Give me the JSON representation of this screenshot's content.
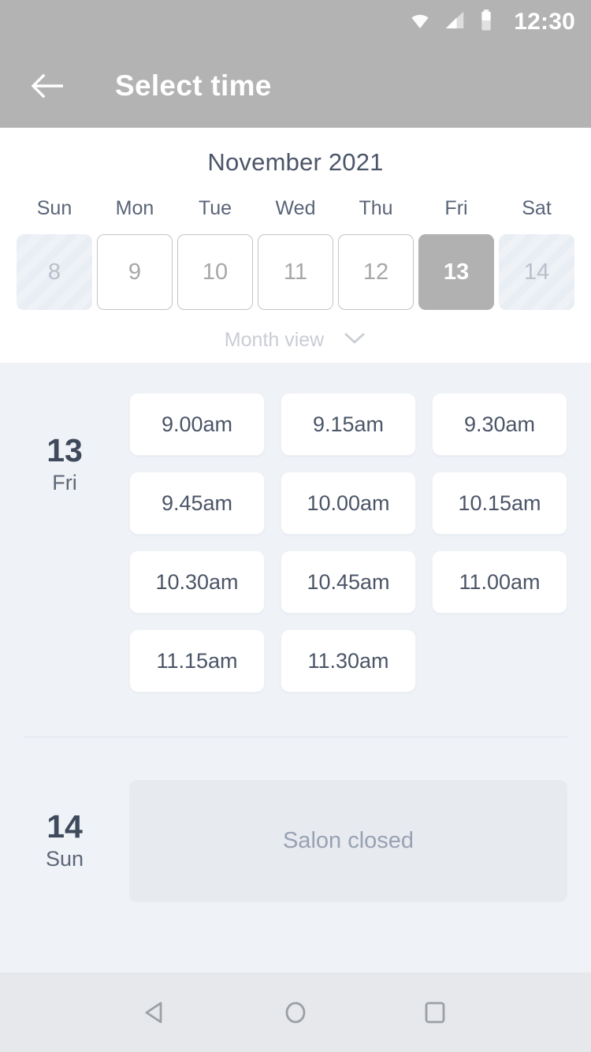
{
  "status_bar": {
    "time": "12:30",
    "icons": [
      "wifi-icon",
      "signal-icon",
      "battery-icon"
    ]
  },
  "app_bar": {
    "back_icon": "back-arrow-icon",
    "title": "Select time"
  },
  "calendar": {
    "month_title": "November 2021",
    "weekdays": [
      "Sun",
      "Mon",
      "Tue",
      "Wed",
      "Thu",
      "Fri",
      "Sat"
    ],
    "days": [
      {
        "label": "8",
        "state": "disabled"
      },
      {
        "label": "9",
        "state": "enabled"
      },
      {
        "label": "10",
        "state": "enabled"
      },
      {
        "label": "11",
        "state": "enabled"
      },
      {
        "label": "12",
        "state": "enabled"
      },
      {
        "label": "13",
        "state": "selected"
      },
      {
        "label": "14",
        "state": "disabled"
      }
    ],
    "view_toggle": {
      "label": "Month view",
      "icon": "chevron-down-icon"
    }
  },
  "schedule": {
    "groups": [
      {
        "day_number": "13",
        "day_of_week": "Fri",
        "slots": [
          "9.00am",
          "9.15am",
          "9.30am",
          "9.45am",
          "10.00am",
          "10.15am",
          "10.30am",
          "10.45am",
          "11.00am",
          "11.15am",
          "11.30am"
        ]
      },
      {
        "day_number": "14",
        "day_of_week": "Sun",
        "closed_message": "Salon closed"
      }
    ]
  },
  "nav_bar": {
    "buttons": [
      "back-nav-icon",
      "home-nav-icon",
      "recents-nav-icon"
    ]
  },
  "colors": {
    "app_bar": "#b3b3b3",
    "selected_day": "#b1b1b1",
    "page_bg": "#eff2f7",
    "text_dark": "#4b5567",
    "text_muted": "#98a2b3"
  }
}
